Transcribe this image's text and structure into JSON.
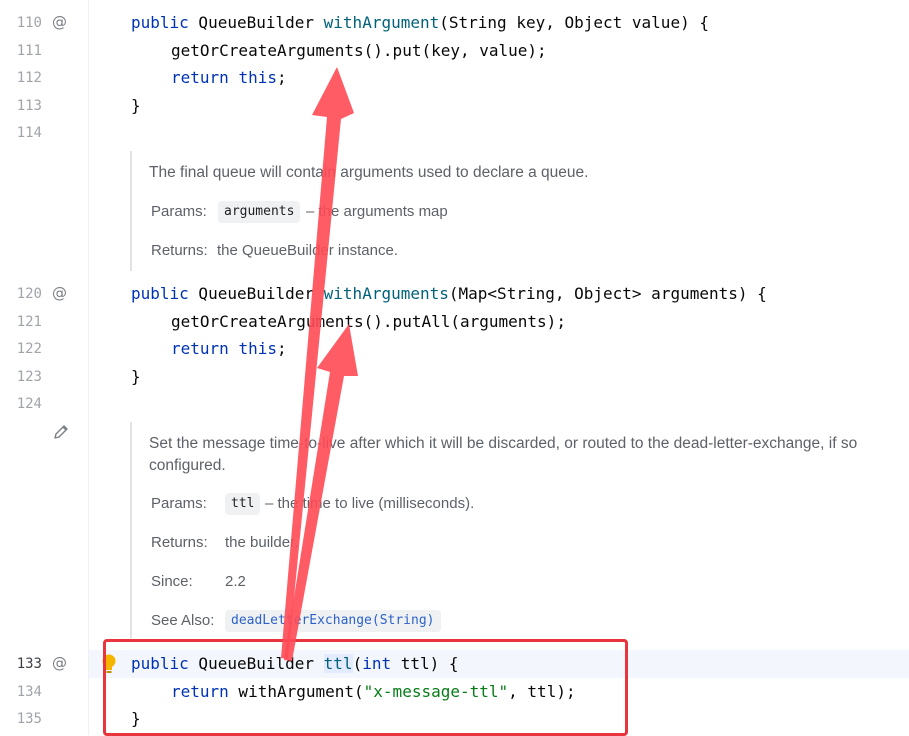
{
  "gutter": {
    "lines": [
      {
        "n": "110",
        "at": "@"
      },
      {
        "n": "111"
      },
      {
        "n": "112"
      },
      {
        "n": "113"
      },
      {
        "n": "114"
      },
      {
        "n": "120",
        "at": "@"
      },
      {
        "n": "121"
      },
      {
        "n": "122"
      },
      {
        "n": "123"
      },
      {
        "n": "124"
      },
      {
        "n": "133",
        "at": "@"
      },
      {
        "n": "134"
      },
      {
        "n": "135"
      }
    ]
  },
  "code": {
    "m1_sig": {
      "kw": "public",
      "type": " QueueBuilder ",
      "name": "withArgument",
      "params": "(String key, Object value) {"
    },
    "m1_l1": "getOrCreateArguments().put(key, value);",
    "m1_l2": {
      "kw": "return",
      "this": "this",
      "end": ";"
    },
    "m1_close": "}",
    "m2_sig": {
      "kw": "public",
      "type": " QueueBuilder ",
      "name": "withArguments",
      "params": "(Map<String, Object> arguments) {"
    },
    "m2_l1": "getOrCreateArguments().putAll(arguments);",
    "m2_l2": {
      "kw": "return",
      "this": "this",
      "end": ";"
    },
    "m2_close": "}",
    "m3_sig": {
      "kw": "public",
      "type": " QueueBuilder ",
      "name": "ttl",
      "open": "(",
      "ptype": "int",
      "params": " ttl) {"
    },
    "m3_l1": {
      "kw": "return",
      "call": " withArgument(",
      "str": "\"x-message-ttl\"",
      "end": ", ttl);"
    },
    "m3_close": "}"
  },
  "doc1": {
    "text": "The final queue will contain arguments used to declare a queue.",
    "params_label": "Params:",
    "params_chip": "arguments",
    "params_desc": "– the arguments map",
    "returns_label": "Returns:",
    "returns_desc": "the QueueBuilder instance."
  },
  "doc2": {
    "text_l1": "Set the message time-to-live after which it will be discarded, or routed to the dead-letter-exchange, if so",
    "text_l2": "configured.",
    "params_label": "Params:",
    "params_chip": "ttl",
    "params_desc": "– the time to live (milliseconds).",
    "returns_label": "Returns:",
    "returns_desc": "the builder.",
    "since_label": "Since:",
    "since_value": "2.2",
    "see_label": "See Also:",
    "see_link": "deadLetterExchange(String)"
  },
  "colors": {
    "keyword": "#0033b3",
    "method": "#00627a",
    "string": "#067d17",
    "annotation_arrow": "#ff4a55",
    "highlight_box": "#e8343c"
  }
}
